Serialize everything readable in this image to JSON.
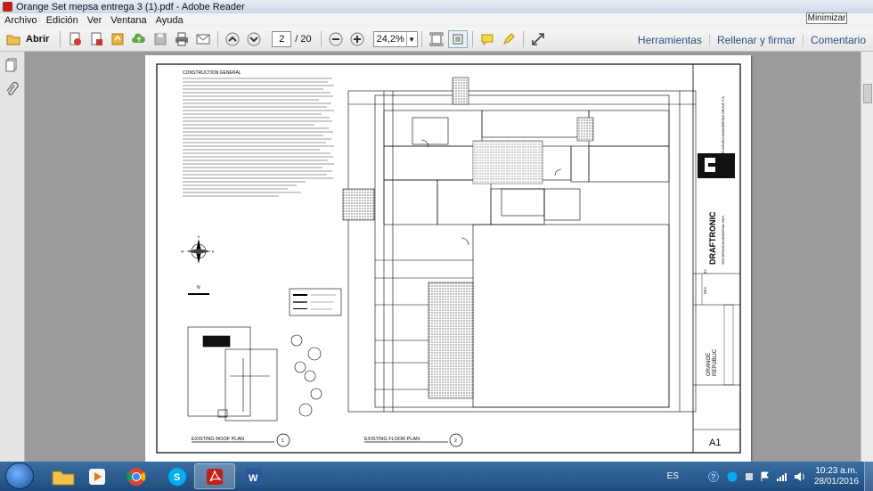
{
  "window": {
    "title": "Orange Set mepsa entrega 3 (1).pdf - Adobe Reader",
    "tooltip": "Minimizar"
  },
  "menu": [
    "Archivo",
    "Edición",
    "Ver",
    "Ventana",
    "Ayuda"
  ],
  "toolbar": {
    "open_label": "Abrir",
    "current_page": "2",
    "page_total": "/ 20",
    "zoom": "24,2%"
  },
  "right_links": [
    "Herramientas",
    "Rellenar y firmar",
    "Comentario"
  ],
  "drawing": {
    "notes_title": "CONSTRUCTION GENERAL",
    "roof_plan_label": "EXISTING ROOF PLAN",
    "roof_plan_number": "1",
    "floor_plan_label": "EXISTING FLOOR PLAN",
    "floor_plan_number": "2",
    "sheet_number": "A1",
    "logo_text": "DRAFTRONIC",
    "company_line1": "PLAGUENI ENGINEERING GROUP, P.A.",
    "company_line2": "3950 BRONSON MEMORIAL HWY.",
    "project_line1": "ORANGE",
    "project_line2": "REPUBLIC",
    "rev_label": "REV.",
    "by_label": "BY",
    "north_label": "N",
    "compass_e": "E",
    "compass_w": "W",
    "compass_s": "S"
  },
  "taskbar": {
    "language": "ES",
    "time": "10:23 a.m.",
    "date": "28/01/2016"
  }
}
